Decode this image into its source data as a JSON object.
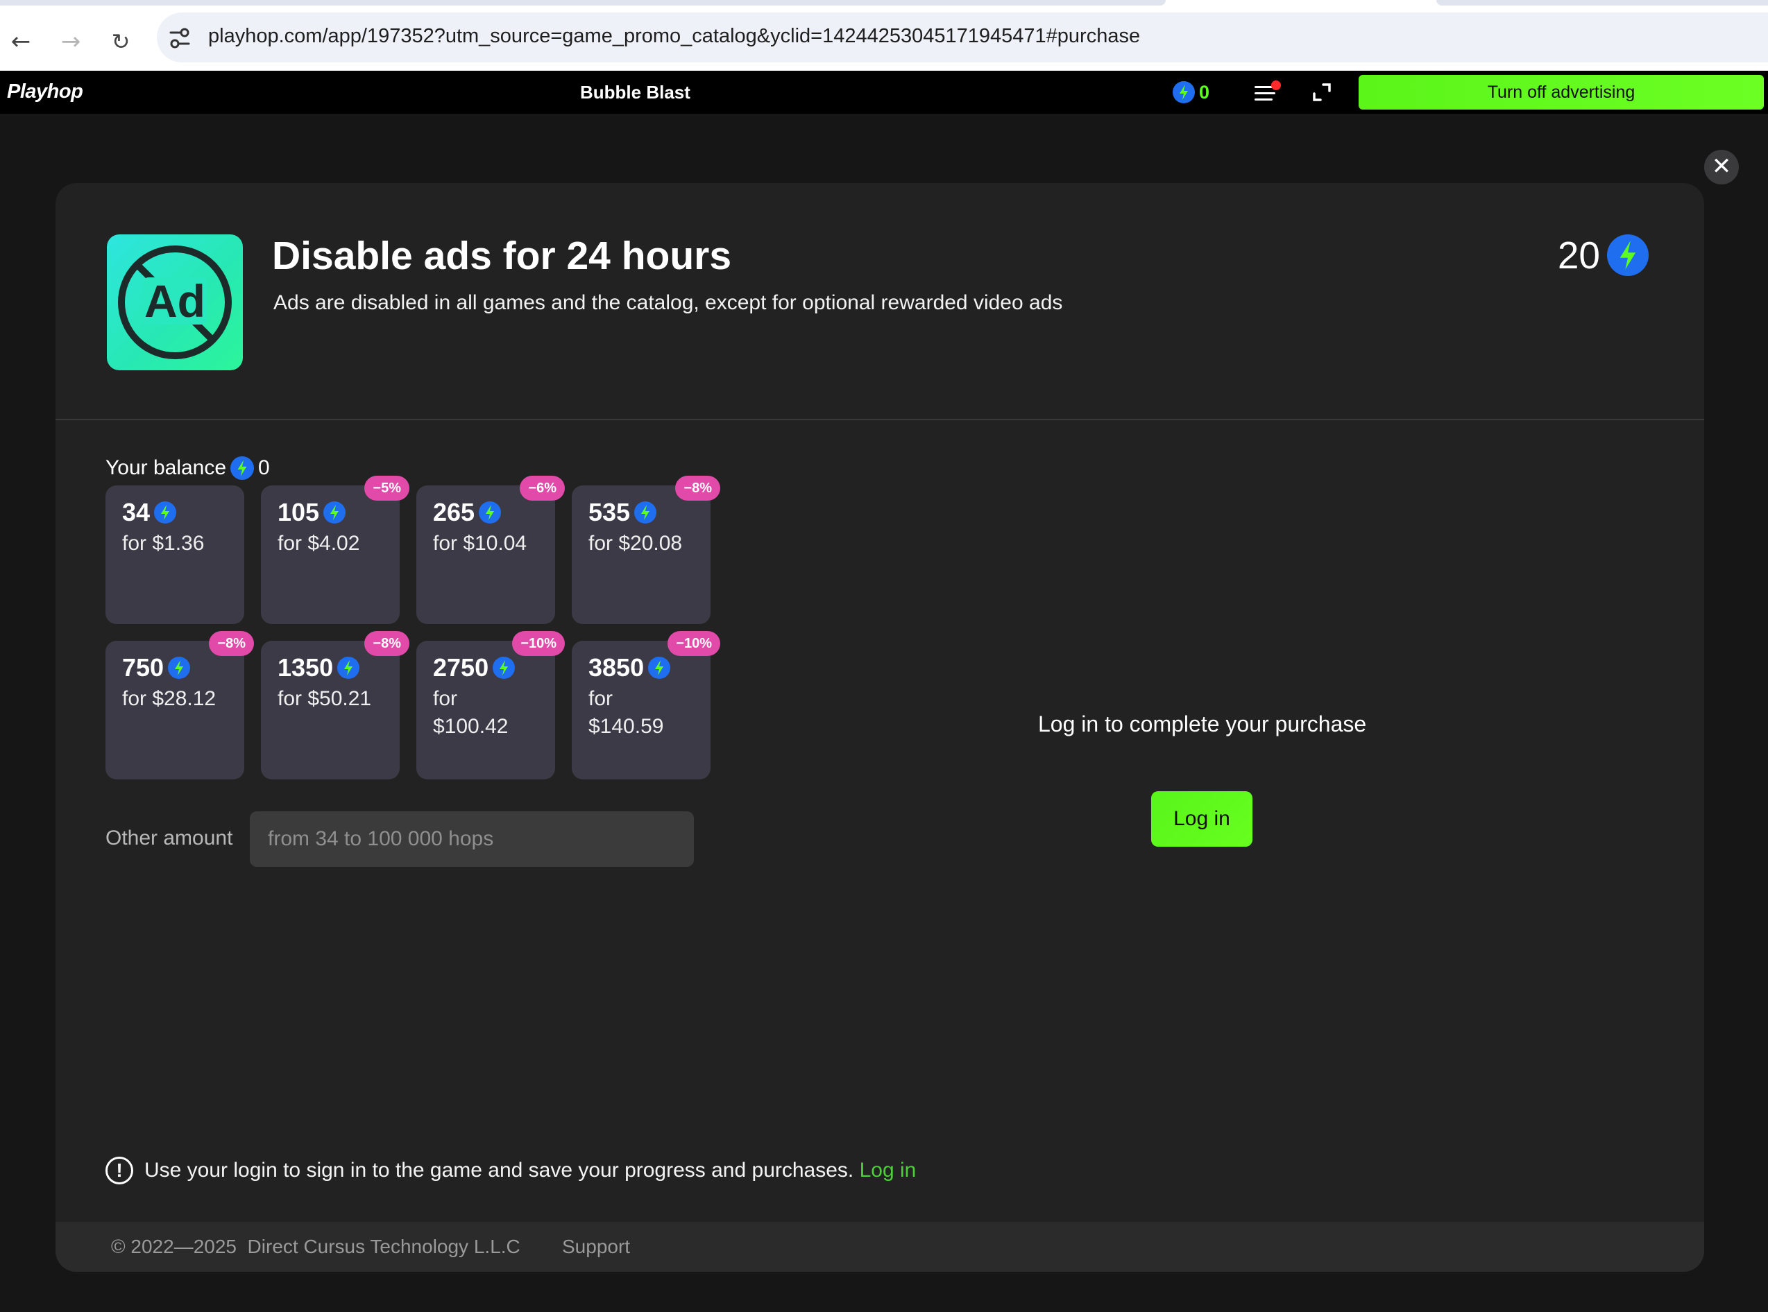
{
  "browser": {
    "url_host": "playhop.com",
    "url_rest": "/app/197352?utm_source=game_promo_catalog&yclid=14244253045171945471#purchase",
    "icons": [
      "back-arrow-icon",
      "forward-arrow-icon",
      "reload-icon",
      "site-info-icon"
    ]
  },
  "header": {
    "logo": "Playhop",
    "game_title": "Bubble Blast",
    "balance": "0",
    "ad_off_label": "Turn off advertising",
    "icons": [
      "hop-bolt-icon",
      "menu-icon",
      "fullscreen-icon"
    ]
  },
  "product": {
    "title": "Disable ads for 24 hours",
    "description": "Ads are disabled in all games and the catalog, except for optional rewarded video ads",
    "price": "20",
    "icon_text": "Ad"
  },
  "balance": {
    "label": "Your balance",
    "value": "0"
  },
  "packs": [
    {
      "amount": "34",
      "price": "for $1.36",
      "badge": ""
    },
    {
      "amount": "105",
      "price": "for $4.02",
      "badge": "−5%"
    },
    {
      "amount": "265",
      "price": "for $10.04",
      "badge": "−6%"
    },
    {
      "amount": "535",
      "price": "for $20.08",
      "badge": "−8%"
    },
    {
      "amount": "750",
      "price": "for $28.12",
      "badge": "−8%"
    },
    {
      "amount": "1350",
      "price": "for $50.21",
      "badge": "−8%"
    },
    {
      "amount": "2750",
      "price": "for $100.42",
      "badge": "−10%"
    },
    {
      "amount": "3850",
      "price": "for $140.59",
      "badge": "−10%"
    }
  ],
  "other_amount": {
    "label": "Other amount",
    "placeholder": "from 34 to 100 000 hops",
    "value": ""
  },
  "login": {
    "prompt": "Log in to complete your purchase",
    "button": "Log in"
  },
  "notice": {
    "text": "Use your login to sign in to the game and save your progress and purchases.",
    "link": "Log in"
  },
  "footer": {
    "copyright": "© 2022—2025  Direct Cursus Technology L.L.C",
    "support": "Support"
  },
  "colors": {
    "accent_green": "#5cff1e",
    "hop_blue": "#1f6eef",
    "badge_pink": "#e14aa8",
    "card_bg": "#3b3a46"
  }
}
